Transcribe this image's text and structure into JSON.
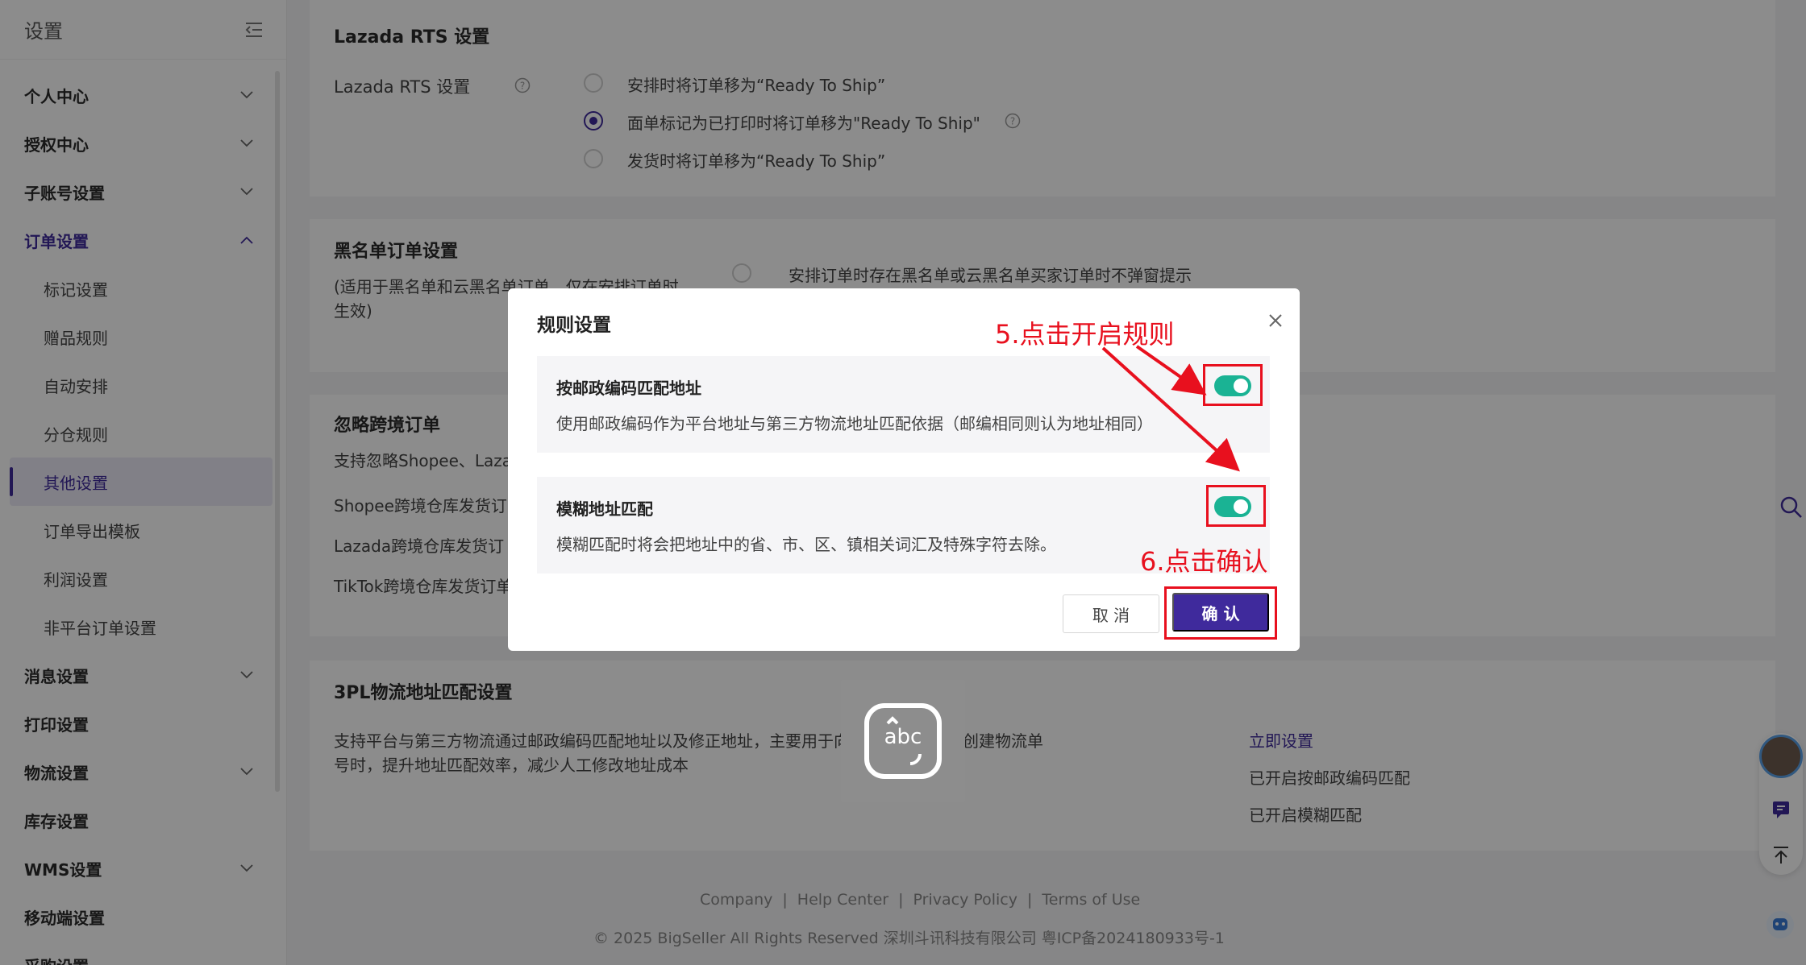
{
  "sidebar": {
    "title": "设置",
    "items": [
      {
        "label": "个人中心",
        "chevron": "down"
      },
      {
        "label": "授权中心",
        "chevron": "down"
      },
      {
        "label": "子账号设置",
        "chevron": "down"
      },
      {
        "label": "订单设置",
        "chevron": "up",
        "open": true
      },
      {
        "label": "消息设置",
        "chevron": "down"
      },
      {
        "label": "打印设置",
        "chevron": ""
      },
      {
        "label": "物流设置",
        "chevron": "down"
      },
      {
        "label": "库存设置",
        "chevron": ""
      },
      {
        "label": "WMS设置",
        "chevron": "down"
      },
      {
        "label": "移动端设置",
        "chevron": ""
      },
      {
        "label": "采购设置",
        "chevron": ""
      }
    ],
    "sub_items": [
      "标记设置",
      "赠品规则",
      "自动安排",
      "分仓规则",
      "其他设置",
      "订单导出模板",
      "利润设置",
      "非平台订单设置"
    ],
    "active_sub": "其他设置"
  },
  "lazada": {
    "title": "Lazada RTS 设置",
    "label": "Lazada RTS 设置",
    "options": [
      "安排时将订单移为“Ready To Ship”",
      "面单标记为已打印时将订单移为\"Ready To Ship\"",
      "发货时将订单移为“Ready To Ship”"
    ],
    "selected_index": 1
  },
  "blacklist": {
    "title": "黑名单订单设置",
    "desc_line1": "(适用于黑名单和云黑名单订单，仅在安排订单时",
    "desc_line2": "生效)",
    "option": "安排订单时存在黑名单或云黑名单买家订单时不弹窗提示"
  },
  "crossborder": {
    "title": "忽略跨境订单",
    "desc": "支持忽略Shopee、Laza",
    "rows": [
      "Shopee跨境仓库发货订",
      "Lazada跨境仓库发货订",
      "TikTok跨境仓库发货订单"
    ]
  },
  "tpl": {
    "title": "3PL物流地址匹配设置",
    "desc_line1": "支持平台与第三方物流通过邮政编码匹配地址以及修正地址，主要用于向第三方物流申请创建物流单",
    "desc_line2": "号时，提升地址匹配效率，减少人工修改地址成本",
    "setup_link": "立即设置",
    "status1": "已开启按邮政编码匹配",
    "status2": "已开启模糊匹配"
  },
  "modal": {
    "title": "规则设置",
    "rules": [
      {
        "title": "按邮政编码匹配地址",
        "desc": "使用邮政编码作为平台地址与第三方物流地址匹配依据（邮编相同则认为地址相同）",
        "enabled": true
      },
      {
        "title": "模糊地址匹配",
        "desc": "模糊匹配时将会把地址中的省、市、区、镇相关词汇及特殊字符去除。",
        "enabled": true
      }
    ],
    "cancel_label": "取 消",
    "ok_label": "确 认"
  },
  "annotations": {
    "step5": "5.点击开启规则",
    "step6": "6.点击确认",
    "color": "#e8101e"
  },
  "ime_label": "abc",
  "footer": {
    "links": [
      "Company",
      "Help Center",
      "Privacy Policy",
      "Terms of Use"
    ],
    "copyright": "© 2025 BigSeller All Rights Reserved   深圳斗讯科技有限公司   粤ICP备2024180933号-1"
  },
  "colors": {
    "accent": "#3f2a9c",
    "toggle": "#1ab394"
  }
}
